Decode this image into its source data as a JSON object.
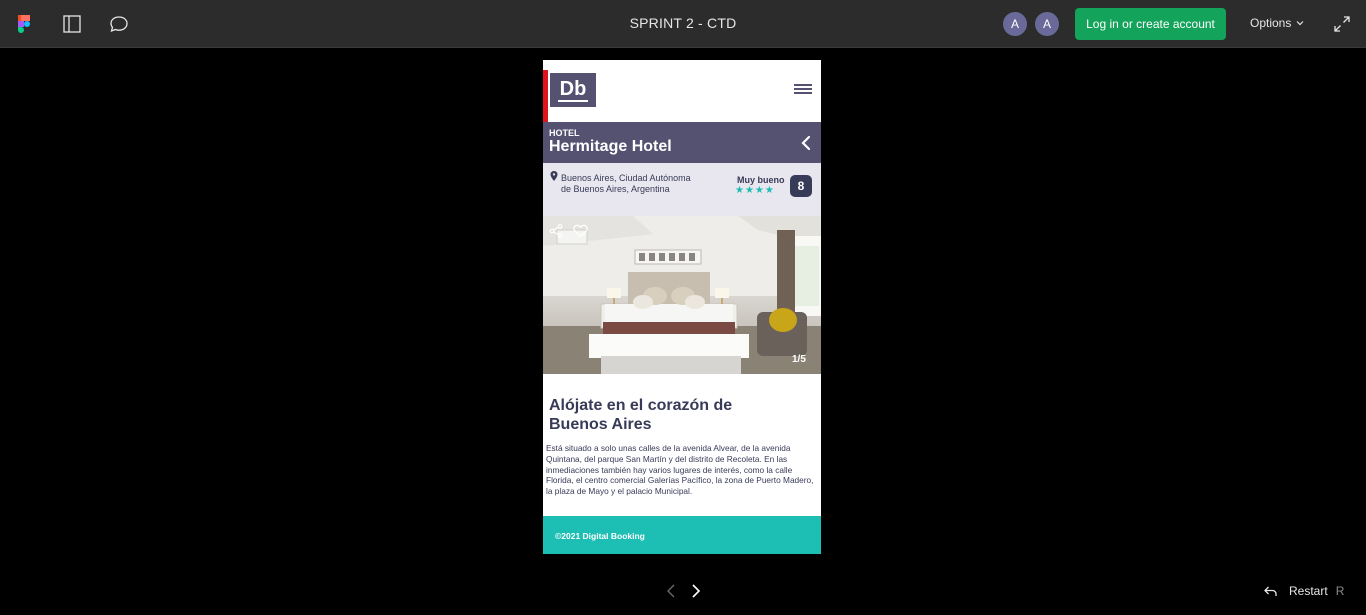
{
  "toolbar": {
    "title": "SPRINT 2 - CTD",
    "avatars": [
      "A",
      "A"
    ],
    "login_label": "Log in or create account",
    "options_label": "Options"
  },
  "hotel": {
    "logo": "Db",
    "category": "HOTEL",
    "name": "Hermitage Hotel",
    "address": "Buenos Aires, Ciudad Autónoma de Buenos Aires, Argentina",
    "rating_label": "Muy bueno",
    "stars": "★★★★",
    "score": "8",
    "image_counter": "1/5",
    "heading": "Alójate en el corazón de Buenos Aires",
    "description": "Está situado a solo unas calles de la avenida Alvear, de la avenida Quintana, del parque San Martín y del distrito de Recoleta. En las inmediaciones también hay varios lugares de interés, como la calle Florida, el centro comercial Galerías Pacífico, la zona de Puerto Madero, la plaza de Mayo y el palacio Municipal.",
    "footer": "©2021 Digital Booking"
  },
  "colors": {
    "brand": "#545171",
    "dark": "#383b58",
    "accent": "#1dbeb4",
    "login": "#14a35a",
    "marker": "#e0141b"
  },
  "bottom": {
    "restart_label": "Restart",
    "restart_key": "R"
  }
}
